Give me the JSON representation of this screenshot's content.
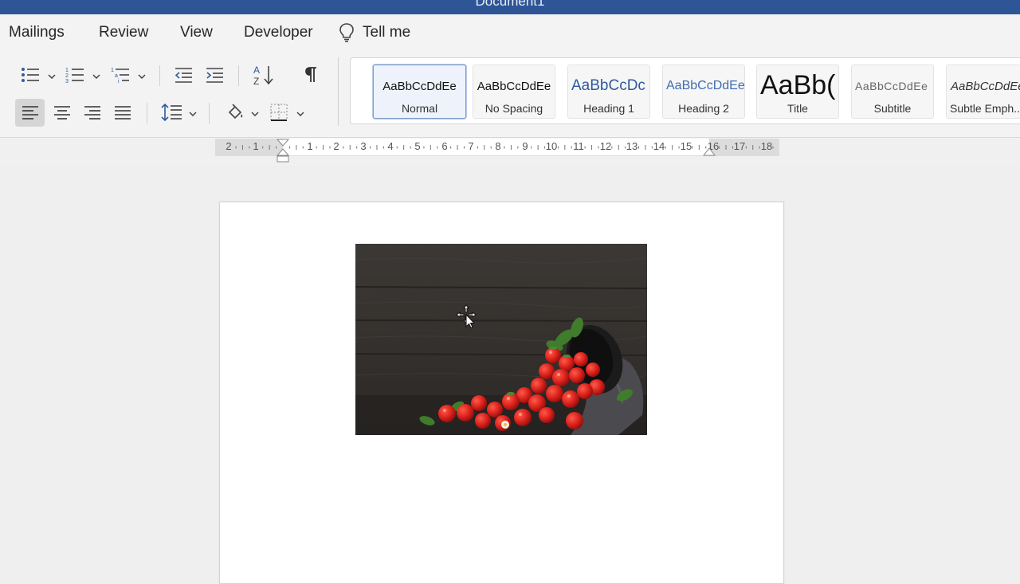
{
  "window": {
    "title": "Document1"
  },
  "tabs": [
    {
      "label": "Mailings"
    },
    {
      "label": "Review"
    },
    {
      "label": "View"
    },
    {
      "label": "Developer"
    }
  ],
  "tell_me": {
    "label": "Tell me"
  },
  "paragraph_tools": {
    "row1": [
      "bullets-icon",
      "numbering-icon",
      "multilevel-list-icon",
      "decrease-indent-icon",
      "increase-indent-icon",
      "sort-icon",
      "pilcrow-icon"
    ],
    "row2": [
      "align-left-icon",
      "align-center-icon",
      "align-right-icon",
      "justify-icon",
      "line-spacing-icon",
      "shading-icon",
      "borders-icon"
    ],
    "active_alignment": "align-left"
  },
  "styles_gallery": {
    "selected": "Normal",
    "items": [
      {
        "sample": "AaBbCcDdEe",
        "label": "Normal"
      },
      {
        "sample": "AaBbCcDdEe",
        "label": "No Spacing"
      },
      {
        "sample": "AaBbCcDc",
        "label": "Heading 1"
      },
      {
        "sample": "AaBbCcDdEe",
        "label": "Heading 2"
      },
      {
        "sample": "AaBb(",
        "label": "Title"
      },
      {
        "sample": "AaBbCcDdEe",
        "label": "Subtitle"
      },
      {
        "sample": "AaBbCcDdEe",
        "label": "Subtle Emph..."
      }
    ]
  },
  "ruler": {
    "left_numbers": [
      "2",
      "1"
    ],
    "right_numbers": [
      "1",
      "2",
      "3",
      "4",
      "5",
      "6",
      "7",
      "8",
      "9",
      "10",
      "11",
      "12",
      "13",
      "14",
      "15",
      "16",
      "17",
      "18"
    ]
  },
  "document": {
    "picture": "strawberries-spilling-from-bowl",
    "cursor": "move-cursor-icon"
  },
  "colors": {
    "title_bar": "#2e5596",
    "ribbon_bg": "#f3f3f3",
    "canvas_bg": "#efefef",
    "selected_style_border": "#7f9cc9",
    "icon_blue": "#2f5a9e"
  }
}
